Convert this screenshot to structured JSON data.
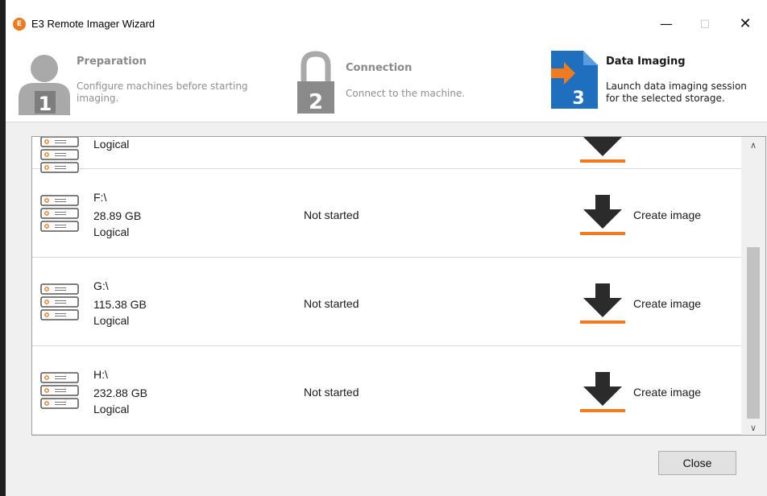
{
  "window": {
    "title": "E3 Remote Imager Wizard",
    "app_icon": "e3-logo-icon",
    "controls": {
      "minimize": "—",
      "maximize": "□",
      "close": "✕"
    }
  },
  "steps": [
    {
      "number": "1",
      "title": "Preparation",
      "description_line1": "Configure machines before starting",
      "description_line2": "imaging.",
      "icon": "user-icon",
      "state": "inactive"
    },
    {
      "number": "2",
      "title": "Connection",
      "description": "Connect to the machine.",
      "icon": "padlock-icon",
      "state": "inactive"
    },
    {
      "number": "3",
      "title": "Data Imaging",
      "description_line1": "Launch data imaging session",
      "description_line2": "for the selected storage.",
      "icon": "data-imaging-icon",
      "state": "active"
    }
  ],
  "drives": [
    {
      "letter": "",
      "size": "",
      "type": "Logical",
      "status": "",
      "action": "",
      "partial": true
    },
    {
      "letter": "F:\\",
      "size": "28.89 GB",
      "type": "Logical",
      "status": "Not started",
      "action": "Create image"
    },
    {
      "letter": "G:\\",
      "size": "115.38 GB",
      "type": "Logical",
      "status": "Not started",
      "action": "Create image"
    },
    {
      "letter": "H:\\",
      "size": "232.88 GB",
      "type": "Logical",
      "status": "Not started",
      "action": "Create image"
    }
  ],
  "scrollbar": {
    "up_arrow": "∧",
    "down_arrow": "∨"
  },
  "footer": {
    "close_label": "Close"
  },
  "colors": {
    "accent_orange": "#f07a1f",
    "download_arrow": "#2b2b2b",
    "active_step_blue": "#1f6fbf",
    "inactive_step_gray": "#9a9a9a"
  }
}
